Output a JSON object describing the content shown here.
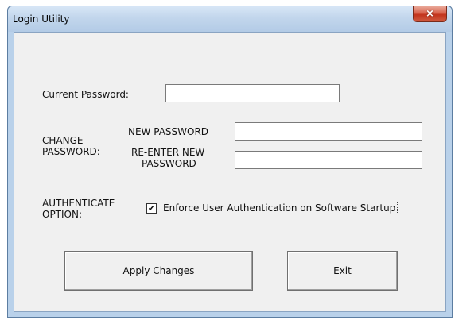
{
  "window": {
    "title": "Login Utility",
    "close_glyph": "×"
  },
  "current_password": {
    "label": "Current Password:",
    "value": ""
  },
  "change_password": {
    "group_label_1": "CHANGE",
    "group_label_2": "PASSWORD:",
    "new_label": "NEW PASSWORD",
    "new_value": "",
    "reenter_label_1": "RE-ENTER NEW",
    "reenter_label_2": "PASSWORD",
    "reenter_value": ""
  },
  "authenticate": {
    "label_1": "AUTHENTICATE",
    "label_2": "OPTION:",
    "checkbox_label": "Enforce User Authentication on Software Startup",
    "checked": true,
    "check_glyph": "✔"
  },
  "buttons": {
    "apply": "Apply Changes",
    "exit": "Exit"
  }
}
